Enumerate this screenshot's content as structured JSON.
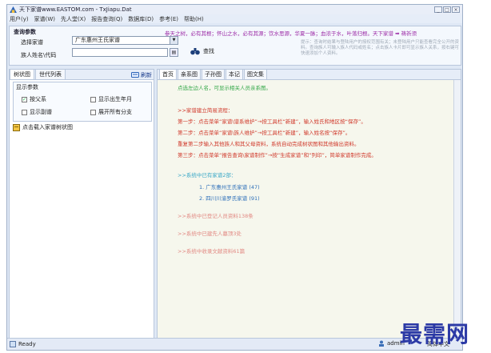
{
  "window": {
    "title": "天下家谱www.EASTOM.com - TxJiapu.Dat",
    "controls": [
      "_",
      "□",
      "×"
    ]
  },
  "menu": [
    "用户(y)",
    "家谱(W)",
    "先人堂(X)",
    "报告查询(Q)",
    "数据库(D)",
    "参考(E)",
    "帮助(H)"
  ],
  "query": {
    "title": "查询参数",
    "select_label": "选择家谱",
    "select_value": "广东惠州王氏家谱",
    "id_label": "族人姓名\\代码",
    "id_value": "",
    "search_label": "查找",
    "slogan": "参天之树，必有其根；怀山之水，必有其源；饮水思源，华夏一脉；血浓于水，叶落归根。天下家谱 ➡ 祷祈须",
    "tips": "提示：查询时结果与登陆用户的授权范围有关；未登陆用户只能查看完全公开的资料。查询族人可输入族人代码或姓名；点击族人卡片即可显示族人关系，按右键可快速添加个人资料。"
  },
  "left_panel": {
    "tabs": [
      "树状图",
      "世代列表"
    ],
    "refresh_label": "刷新",
    "display_title": "显示参数",
    "options": [
      {
        "label": "按父系",
        "checked": true
      },
      {
        "label": "显示出生年月",
        "checked": false
      },
      {
        "label": "显示副谱",
        "checked": false
      },
      {
        "label": "展开所有分支",
        "checked": false
      }
    ],
    "tree_item": "点击载入家谱树状图"
  },
  "main": {
    "tabs": [
      "首页",
      "亲系图",
      "子孙图",
      "本记",
      "图文集"
    ],
    "top_hint": "点选左边人名，可显示相关人员亲系图。",
    "steps_title": ">>家谱建立简易流程：",
    "steps": [
      "第一步：点击菜单“家谱\\谱系维护”→按工具栏“新建”，输入姓氏和地区按“保存”。",
      "第二步：点击菜单“家谱\\族人维护”→按工具栏“新建”，输入姓名按“保存”。",
      "重复第二步输入其他族人和其父母资料，系统自动完成树状图和其他输出资料。",
      "第三步：点击菜单“报告查询\\家谱制作”→按“生成家谱”和“列印”，简单家谱制作完成。"
    ],
    "existing_title": ">>系统中已有家谱2部：",
    "existing": [
      "1. 广东惠州王氏家谱 (47)",
      "2. 四川川渝罗氏家谱 (91)"
    ],
    "stat1": ">>系统中已登记人员资料138条",
    "stat2": ">>系统中已建先人墓顶3处",
    "stat3": ">>系统中收录文献资料61篇"
  },
  "status": {
    "ready": "Ready",
    "user": "admin",
    "lang": "简体中文"
  },
  "watermark": "最需网"
}
